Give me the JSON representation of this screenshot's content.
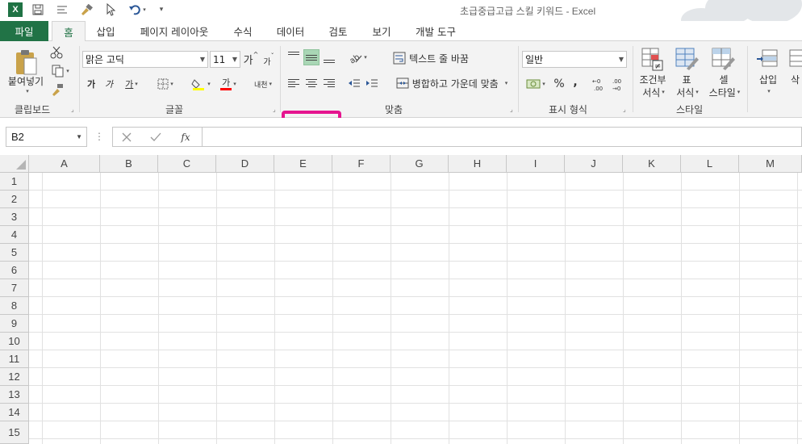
{
  "titlebar": {
    "title": "초급중급고급 스킬 키워드 - Excel",
    "app_logo": "X"
  },
  "tabs": [
    {
      "label": "파일"
    },
    {
      "label": "홈"
    },
    {
      "label": "삽입"
    },
    {
      "label": "페이지 레이아웃"
    },
    {
      "label": "수식"
    },
    {
      "label": "데이터"
    },
    {
      "label": "검토"
    },
    {
      "label": "보기"
    },
    {
      "label": "개발 도구"
    }
  ],
  "ribbon": {
    "clipboard": {
      "paste": "붙여넣기",
      "label": "클립보드"
    },
    "font": {
      "name": "맑은 고딕",
      "size": "11",
      "bold": "가",
      "italic": "가",
      "underline": "가",
      "grow": "가",
      "shrink": "가",
      "color_letter": "가",
      "phonetic": "내천",
      "label": "글꼴"
    },
    "alignment": {
      "wrap": "텍스트 줄 바꿈",
      "merge": "병합하고 가운데 맞춤",
      "label": "맞춤"
    },
    "number": {
      "format": "일반",
      "percent": "%",
      "comma": ",",
      "label": "표시 형식"
    },
    "styles": {
      "conditional_l1": "조건부",
      "conditional_l2": "서식",
      "table_l1": "표",
      "table_l2": "서식",
      "cell_l1": "셀",
      "cell_l2": "스타일",
      "label": "스타일"
    },
    "cells": {
      "insert": "삽입",
      "delete": "삭"
    }
  },
  "formula_bar": {
    "name_box": "B2",
    "fx": "fx",
    "value": ""
  },
  "columns": [
    "A",
    "B",
    "C",
    "D",
    "E",
    "F",
    "G",
    "H",
    "I",
    "J",
    "K",
    "L",
    "M"
  ],
  "rows": [
    "1",
    "2",
    "3",
    "4",
    "5",
    "6",
    "7",
    "8",
    "9",
    "10",
    "11",
    "12",
    "13",
    "14",
    "15"
  ],
  "colors": {
    "brand": "#217346",
    "highlight": "#e5158f",
    "active_align": "#a9d6b5"
  }
}
